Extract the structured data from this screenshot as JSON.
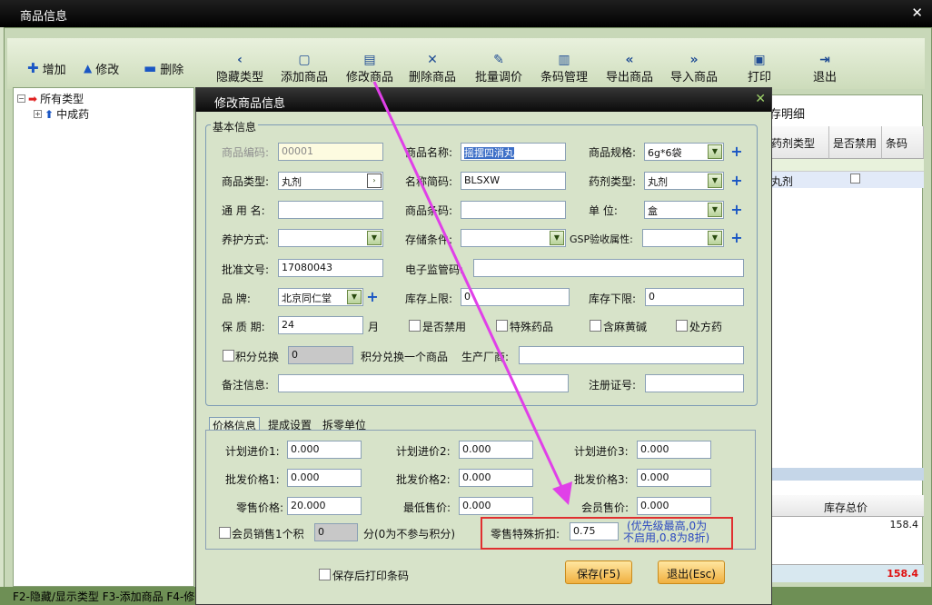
{
  "window": {
    "title": "商品信息",
    "close": "✕"
  },
  "left_toolbar": {
    "add": "增加",
    "edit": "修改",
    "delete": "删除"
  },
  "toolbar": [
    {
      "label": "隐藏类型",
      "icon": "‹"
    },
    {
      "label": "添加商品",
      "icon": "▢"
    },
    {
      "label": "修改商品",
      "icon": "▤"
    },
    {
      "label": "删除商品",
      "icon": "✕"
    },
    {
      "label": "批量调价",
      "icon": "✎"
    },
    {
      "label": "条码管理",
      "icon": "▥"
    },
    {
      "label": "导出商品",
      "icon": "«"
    },
    {
      "label": "导入商品",
      "icon": "»"
    },
    {
      "label": "打印",
      "icon": "▣"
    },
    {
      "label": "退出",
      "icon": "⇥"
    }
  ],
  "tree": {
    "root": "所有类型",
    "child": "中成药"
  },
  "bg_grid": {
    "tab_fragment": "存明细",
    "col_drug_type": "药剂类型",
    "col_disabled": "是否禁用",
    "col_barcode": "条码",
    "row_drug_type": "丸剂",
    "total_header": "库存总价",
    "total_value": "158.4",
    "grand_total": "158.4"
  },
  "status_bar": "F2-隐藏/显示类型  F3-添加商品  F4-修",
  "dialog": {
    "title": "修改商品信息",
    "close": "✕",
    "basic_legend": "基本信息",
    "fields": {
      "code_label": "商品编码:",
      "code_value": "00001",
      "name_label": "商品名称:",
      "name_value": "摇摆四消丸",
      "spec_label": "商品规格:",
      "spec_value": "6g*6袋",
      "type_label": "商品类型:",
      "type_value": "丸剂",
      "abbr_label": "名称简码:",
      "abbr_value": "BLSXW",
      "drug_type_label": "药剂类型:",
      "drug_type_value": "丸剂",
      "generic_label": "通 用 名:",
      "generic_value": "",
      "barcode_label": "商品条码:",
      "barcode_value": "",
      "unit_label": "单    位:",
      "unit_value": "盒",
      "care_label": "养护方式:",
      "care_value": "",
      "storage_label": "存储条件:",
      "storage_value": "",
      "gsp_label": "GSP验收属性:",
      "gsp_value": "",
      "approval_label": "批准文号:",
      "approval_value": "17080043",
      "ecode_label": "电子监管码:",
      "ecode_value": "",
      "brand_label": "品    牌:",
      "brand_value": "北京同仁堂",
      "stock_max_label": "库存上限:",
      "stock_max_value": "0",
      "stock_min_label": "库存下限:",
      "stock_min_value": "0",
      "shelf_label": "保 质 期:",
      "shelf_value": "24",
      "shelf_unit": "月",
      "cb_disabled": "是否禁用",
      "cb_special": "特殊药品",
      "cb_ephedrine": "含麻黄碱",
      "cb_prescription": "处方药",
      "points_label": "积分兑换",
      "points_value": "0",
      "points_suffix": "积分兑换一个商品",
      "maker_label": "生产厂商:",
      "maker_value": "",
      "remark_label": "备注信息:",
      "remark_value": "",
      "reg_label": "注册证号:",
      "reg_value": ""
    },
    "tabs": [
      "价格信息",
      "提成设置",
      "拆零单位"
    ],
    "price": {
      "plan1_label": "计划进价1:",
      "plan1_value": "0.000",
      "plan2_label": "计划进价2:",
      "plan2_value": "0.000",
      "plan3_label": "计划进价3:",
      "plan3_value": "0.000",
      "whole1_label": "批发价格1:",
      "whole1_value": "0.000",
      "whole2_label": "批发价格2:",
      "whole2_value": "0.000",
      "whole3_label": "批发价格3:",
      "whole3_value": "0.000",
      "retail_label": "零售价格:",
      "retail_value": "20.000",
      "min_label": "最低售价:",
      "min_value": "0.000",
      "member_label": "会员售价:",
      "member_value": "0.000",
      "member_points_label": "会员销售1个积",
      "member_points_value": "0",
      "member_points_suffix": "分(0为不参与积分)",
      "discount_label": "零售特殊折扣:",
      "discount_value": "0.75",
      "discount_note1": "(优先级最高,0为",
      "discount_note2": "不启用,0.8为8折)"
    },
    "print_barcode": "保存后打印条码",
    "save_button": "保存(F5)",
    "exit_button": "退出(Esc)"
  },
  "colors": {
    "accent_arrow": "#e040e8",
    "highlight_box": "#e03030",
    "title_bar": "#000000"
  }
}
